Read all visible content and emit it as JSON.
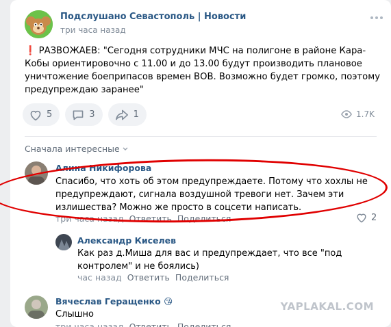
{
  "post": {
    "group_name": "Подслушано Севастополь | Новости",
    "time": "три часа назад",
    "text_prefix": "❗",
    "text": "РАЗВОЖАЕВ: \"Сегодня сотрудники МЧС на полигоне в районе Кара-Кобы ориентировочно с 11.00 и до 13.00 будут производить плановое уничтожение боеприпасов времен ВОВ. Возможно будет громко, поэтому предупреждаю заранее\"",
    "likes": "5",
    "comments": "3",
    "reposts": "1",
    "views": "1.7K"
  },
  "comments": {
    "sort_label": "Сначала интересные",
    "items": [
      {
        "author": "Алина Никифорова",
        "text": "Спасибо, что хоть об этом предупреждаете. Потому что хохлы не предупреждают, сигнала воздушной тревоги нет. Зачем эти излишества? Можно же просто в соцсети написать.",
        "time": "три часа назад",
        "reply": "Ответить",
        "share": "Поделиться",
        "likes": "2"
      },
      {
        "author": "Александр Киселев",
        "text": "Как раз д.Миша для вас и предупреждает, что все \"под контролем\" и не боялись)",
        "time": "час назад",
        "reply": "Ответить",
        "share": "Поделиться"
      },
      {
        "author": "Вячеслав Геращенко",
        "author_emoji": "😘",
        "text": "Слышно",
        "time": "три часа назад",
        "reply": "Ответить",
        "share": "Поделиться"
      }
    ]
  },
  "watermark": "YAPLAKAL.COM",
  "colors": {
    "link": "#2a5885",
    "secondary": "#818c99",
    "annotation": "#e00000"
  }
}
